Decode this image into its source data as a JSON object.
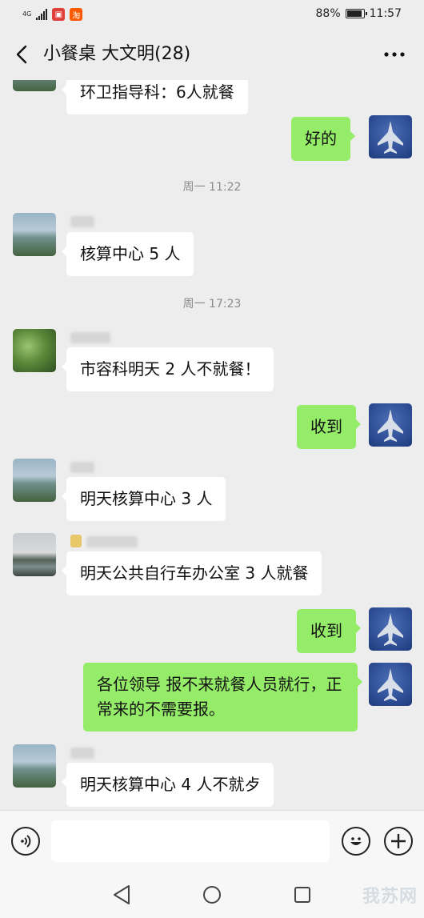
{
  "status_bar": {
    "network": "4G",
    "battery_percent": "88%",
    "battery_level": 0.88,
    "time": "11:57"
  },
  "header": {
    "title": "小餐桌 大文明(28)",
    "back_icon": "back-chevron-icon",
    "more_icon": "more-dots-icon"
  },
  "messages": [
    {
      "type": "incoming",
      "text": "环卫指导科：6人就餐",
      "avatar": "lake"
    },
    {
      "type": "outgoing",
      "text": "好的"
    },
    {
      "type": "timestamp",
      "text": "周一 11:22"
    },
    {
      "type": "incoming",
      "text": "核算中心 5 人",
      "avatar": "lake"
    },
    {
      "type": "timestamp",
      "text": "周一 17:23"
    },
    {
      "type": "incoming",
      "text": "市容科明天 2 人不就餐！",
      "avatar": "leaf"
    },
    {
      "type": "outgoing",
      "text": "收到"
    },
    {
      "type": "incoming",
      "text": "明天核算中心 3 人",
      "avatar": "lake"
    },
    {
      "type": "incoming",
      "text": "明天公共自行车办公室 3 人就餐",
      "avatar": "river"
    },
    {
      "type": "outgoing",
      "text": "收到"
    },
    {
      "type": "outgoing",
      "text": "各位领导  报不来就餐人员就行，正常来的不需要报。"
    },
    {
      "type": "incoming",
      "text": "明天核算中心 4 人不就歺",
      "avatar": "lake"
    }
  ],
  "input_bar": {
    "placeholder": "",
    "voice_icon": "voice-icon",
    "emoji_icon": "emoji-icon",
    "plus_icon": "plus-icon"
  },
  "nav_bar": {
    "back_icon": "nav-back-icon",
    "home_icon": "nav-home-icon",
    "recent_icon": "nav-recent-icon"
  },
  "watermark": "我苏网",
  "colors": {
    "background": "#ededed",
    "outgoing_bubble": "#95ec69",
    "incoming_bubble": "#ffffff",
    "timestamp_text": "#8a8a8a"
  }
}
